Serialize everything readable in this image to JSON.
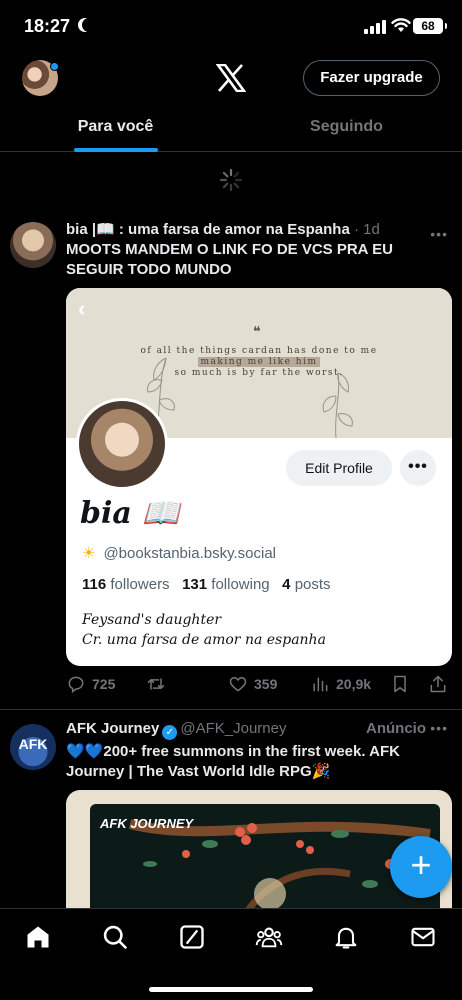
{
  "status_bar": {
    "time": "18:27",
    "battery": "68"
  },
  "header": {
    "upgrade_label": "Fazer upgrade"
  },
  "tabs": [
    {
      "label": "Para você",
      "active": true
    },
    {
      "label": "Seguindo",
      "active": false
    }
  ],
  "tweet1": {
    "author": "bia |📖 : uma farsa de amor na Espanha",
    "meta": "· 1d",
    "text": "MOOTS MANDEM O LINK FO DE VCS PRA EU SEGUIR TODO MUNDO",
    "card": {
      "quote_mark": "❝",
      "quote_line1": "of all the things cardan has done to me",
      "quote_line2": "making me like him",
      "quote_line3": "so much is by far the worst.",
      "edit_profile": "Edit Profile",
      "more": "•••",
      "name": "bia 📖",
      "handle": "@bookstanbia.bsky.social",
      "followers_count": "116",
      "followers_label": "followers",
      "following_count": "131",
      "following_label": "following",
      "posts_count": "4",
      "posts_label": "posts",
      "bio_line1": "Feysand's daughter",
      "bio_line2": "Cr. uma farsa de amor na espanha"
    },
    "actions": {
      "replies": "725",
      "likes": "359",
      "views": "20,9k"
    }
  },
  "tweet2": {
    "author": "AFK Journey",
    "handle": "@AFK_Journey",
    "ad_label": "Anúncio",
    "avatar_text": "AFK",
    "text": "💙💙200+ free summons in the first week. AFK Journey | The Vast World Idle RPG🎉",
    "media_logo": "AFK JOURNEY"
  },
  "colors": {
    "accent": "#1d9bf0",
    "bg": "#000000",
    "muted": "#71767b",
    "border": "#2f3336"
  },
  "icons": [
    "moon-icon",
    "signal-icon",
    "wifi-icon",
    "battery-icon",
    "x-logo",
    "spinner-icon",
    "reply-icon",
    "retweet-icon",
    "heart-icon",
    "views-icon",
    "bookmark-icon",
    "share-icon",
    "verified-icon",
    "plus-icon",
    "home-icon",
    "search-icon",
    "grok-icon",
    "communities-icon",
    "bell-icon",
    "mail-icon"
  ]
}
